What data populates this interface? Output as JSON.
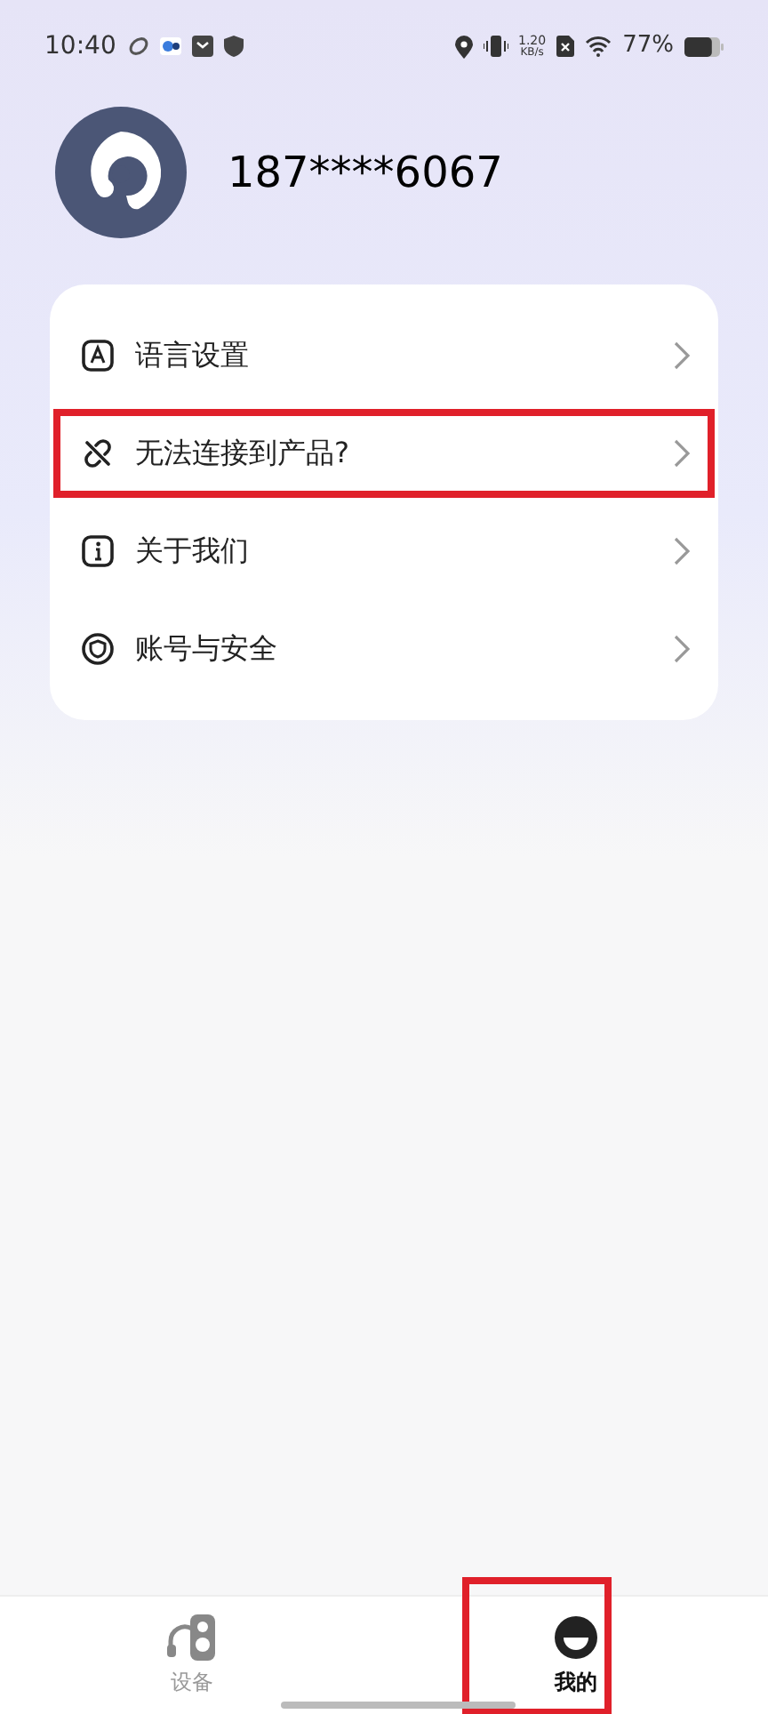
{
  "status_bar": {
    "time": "10:40",
    "speed": "1.20",
    "speed_unit": "KB/s",
    "battery": "77%"
  },
  "profile": {
    "phone": "187****6067"
  },
  "menu": [
    {
      "kind": "language",
      "label": "语言设置",
      "highlighted": false
    },
    {
      "kind": "unlink",
      "label": "无法连接到产品?",
      "highlighted": true
    },
    {
      "kind": "info",
      "label": "关于我们",
      "highlighted": false
    },
    {
      "kind": "security",
      "label": "账号与安全",
      "highlighted": false
    }
  ],
  "tabs": [
    {
      "kind": "devices",
      "label": "设备",
      "selected": false,
      "highlighted": false
    },
    {
      "kind": "me",
      "label": "我的",
      "selected": true,
      "highlighted": true
    }
  ]
}
